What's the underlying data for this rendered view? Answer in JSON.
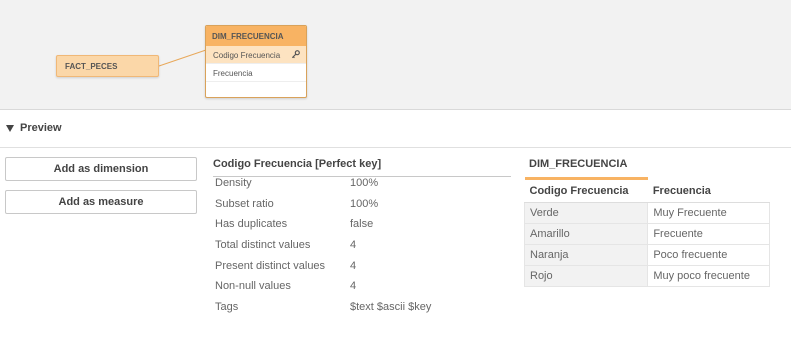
{
  "model": {
    "fact_table": {
      "name": "FACT_PECES"
    },
    "dim_table": {
      "name": "DIM_FRECUENCIA",
      "fields": [
        {
          "label": "Codigo Frecuencia",
          "selected": true,
          "icon": "key-icon"
        },
        {
          "label": "Frecuencia",
          "selected": false
        }
      ]
    },
    "colors": {
      "dim_header": "#f8b363",
      "fact_fill": "#fbd7a8",
      "link": "#e8a85a"
    }
  },
  "preview": {
    "toggle_label": "Preview",
    "buttons": {
      "add_dimension": "Add as dimension",
      "add_measure": "Add as measure"
    },
    "stats": {
      "title": "Codigo Frecuencia [Perfect key]",
      "rows": [
        {
          "label": "Density",
          "value": "100%"
        },
        {
          "label": "Subset ratio",
          "value": "100%"
        },
        {
          "label": "Has duplicates",
          "value": "false"
        },
        {
          "label": "Total distinct values",
          "value": "4"
        },
        {
          "label": "Present distinct values",
          "value": "4"
        },
        {
          "label": "Non-null values",
          "value": "4"
        },
        {
          "label": "Tags",
          "value": "$text $ascii $key"
        }
      ]
    },
    "table": {
      "title": "DIM_FRECUENCIA",
      "columns": [
        "Codigo Frecuencia",
        "Frecuencia"
      ],
      "rows": [
        [
          "Verde",
          "Muy Frecuente"
        ],
        [
          "Amarillo",
          "Frecuente"
        ],
        [
          "Naranja",
          "Poco frecuente"
        ],
        [
          "Rojo",
          "Muy poco frecuente"
        ]
      ]
    }
  }
}
